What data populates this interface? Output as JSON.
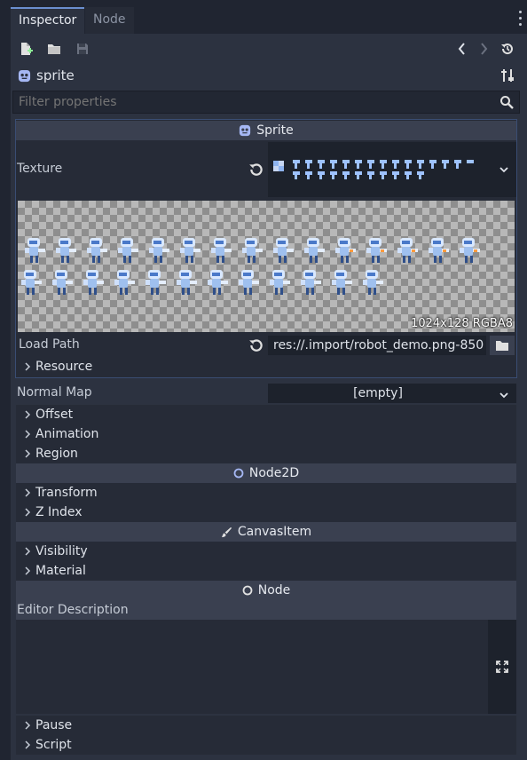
{
  "tabs": [
    {
      "label": "Inspector"
    },
    {
      "label": "Node"
    }
  ],
  "object": {
    "name": "sprite"
  },
  "filter": {
    "placeholder": "Filter properties"
  },
  "sprite_section": {
    "title": "Sprite",
    "texture_label": "Texture",
    "image_info": "1024x128 RGBA8",
    "load_path_label": "Load Path",
    "load_path_value": "res://.import/robot_demo.png-850",
    "resource_label": "Resource",
    "normal_map_label": "Normal Map",
    "normal_map_value": "[empty]",
    "subsections": [
      "Offset",
      "Animation",
      "Region"
    ]
  },
  "node2d_section": {
    "title": "Node2D",
    "subsections": [
      "Transform",
      "Z Index"
    ]
  },
  "canvasitem_section": {
    "title": "CanvasItem",
    "subsections": [
      "Visibility",
      "Material"
    ]
  },
  "node_section": {
    "title": "Node",
    "editor_description_label": "Editor Description",
    "editor_description_value": "",
    "subsections": [
      "Pause",
      "Script"
    ]
  },
  "colors": {
    "accent": "#6b8fd0",
    "panel": "#2c3240",
    "category_bar": "#3a4050",
    "background": "#202531"
  },
  "icons": {
    "new": "new-resource-icon",
    "open": "folder-open-icon",
    "save": "save-icon",
    "back": "chevron-left-icon",
    "forward": "chevron-right-icon",
    "history": "history-icon",
    "object_tools": "tools-icon",
    "search": "search-icon",
    "reload": "reload-icon",
    "expand": "expand-icon"
  }
}
